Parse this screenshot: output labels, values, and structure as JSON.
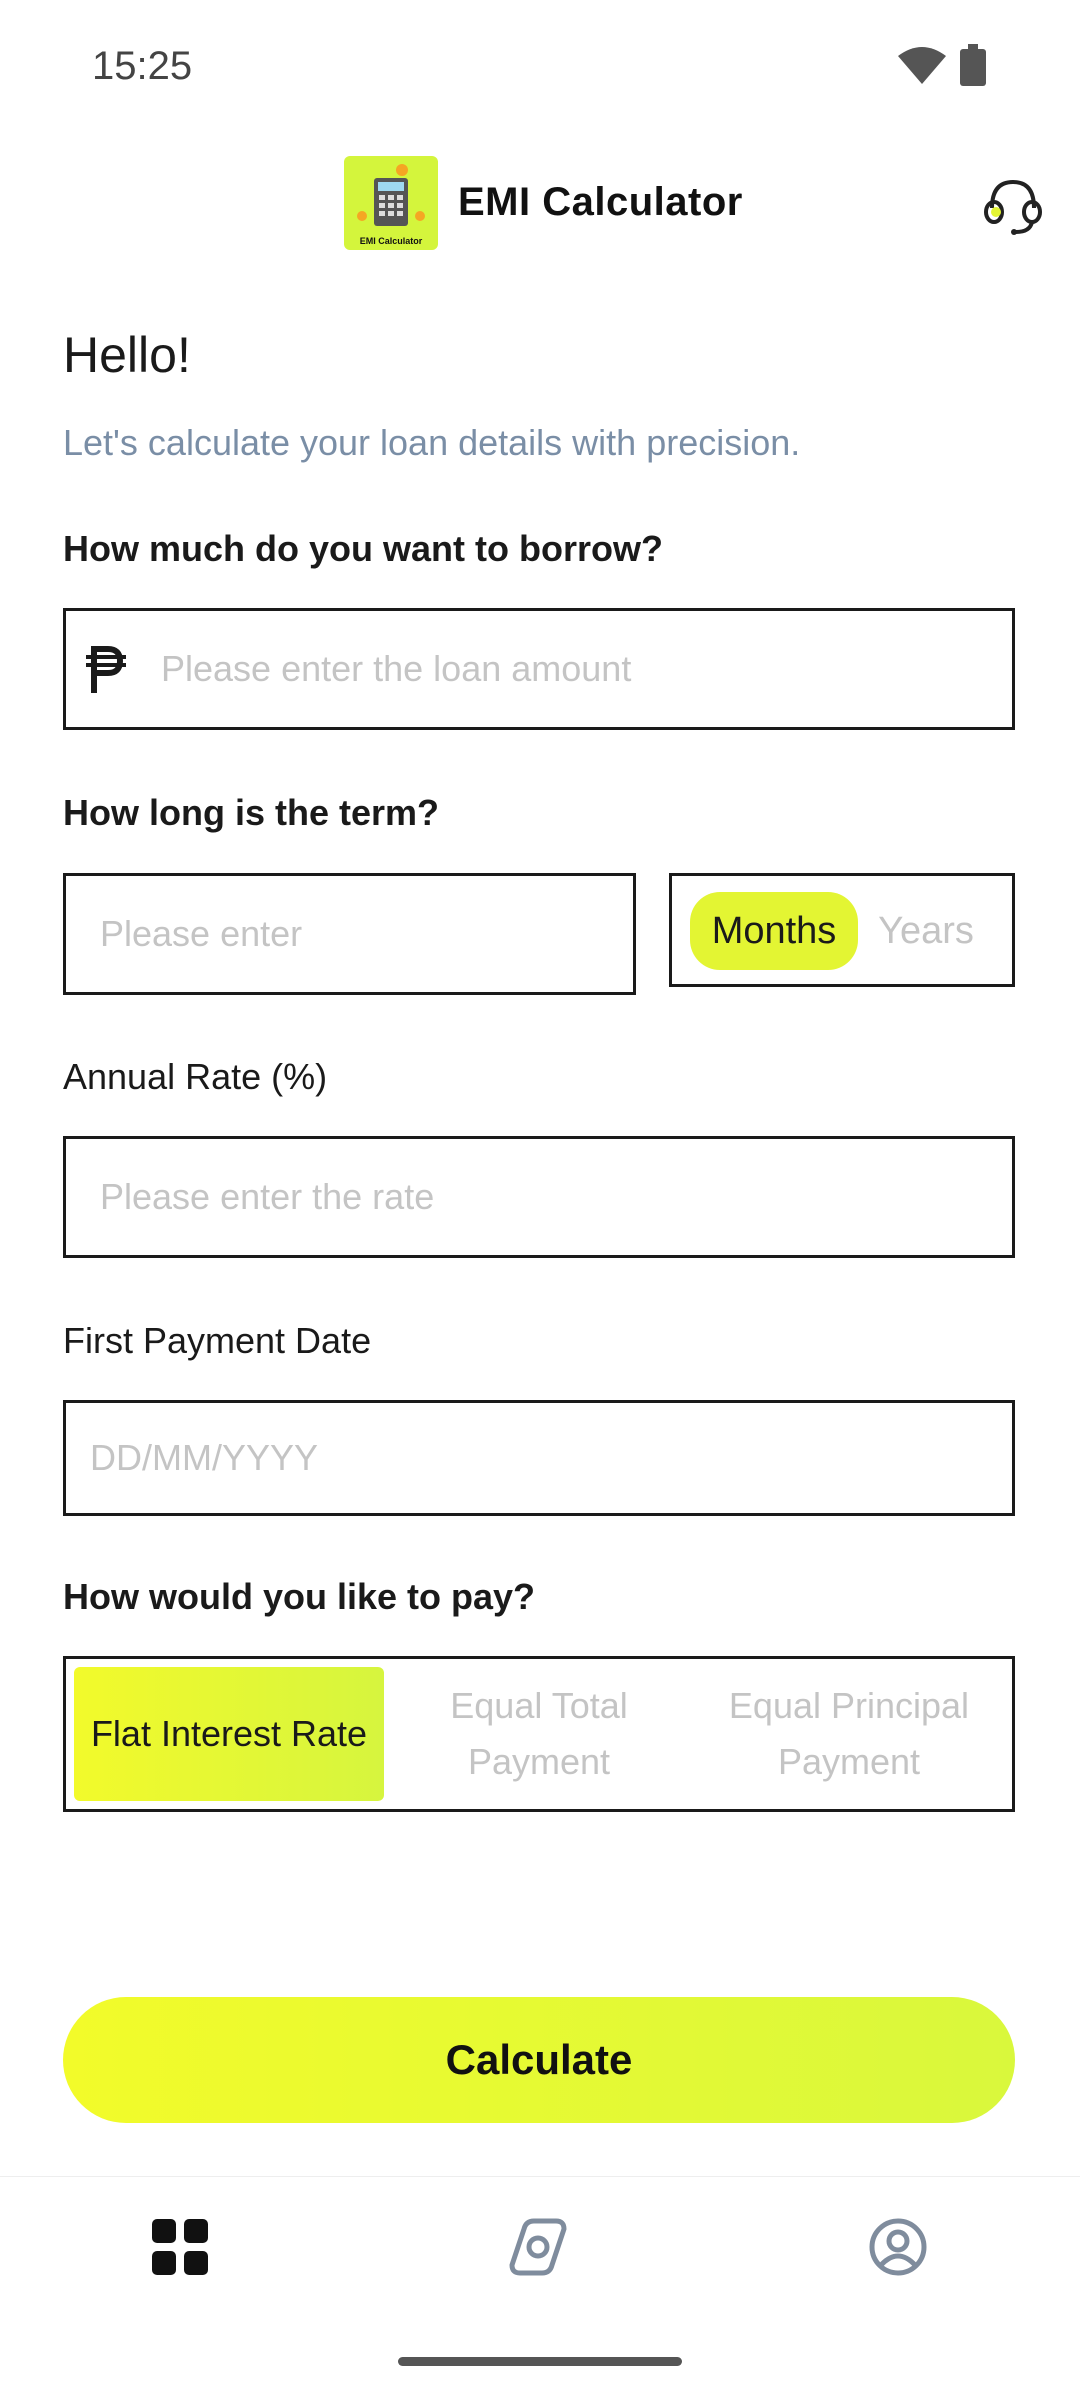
{
  "status_bar": {
    "time": "15:25"
  },
  "header": {
    "logo_text": "EMI Calculator",
    "title": "EMI Calculator"
  },
  "greeting": "Hello!",
  "subtitle": "Let's calculate your loan details with precision.",
  "loan": {
    "label": "How much do you want to borrow?",
    "currency_symbol": "₱",
    "placeholder": "Please enter the loan amount"
  },
  "term": {
    "label": "How long is the term?",
    "placeholder": "Please enter",
    "units": [
      "Months",
      "Years"
    ],
    "selected_unit": "Months"
  },
  "rate": {
    "label": "Annual Rate (%)",
    "placeholder": "Please enter the rate"
  },
  "first_payment": {
    "label": "First Payment Date",
    "placeholder": "DD/MM/YYYY"
  },
  "payment_method": {
    "label": "How would you like to pay?",
    "options": [
      "Flat Interest Rate",
      "Equal Total Payment",
      "Equal Principal Payment"
    ],
    "selected": "Flat Interest Rate"
  },
  "calculate_label": "Calculate",
  "nav": {
    "items": [
      "grid-icon",
      "compass-icon",
      "profile-icon"
    ],
    "active": "grid-icon"
  },
  "colors": {
    "accent": "#e3f533",
    "subtitle": "#7a8ea6",
    "placeholder": "#c4c4c4",
    "nav_inactive": "#7f8c9d"
  }
}
